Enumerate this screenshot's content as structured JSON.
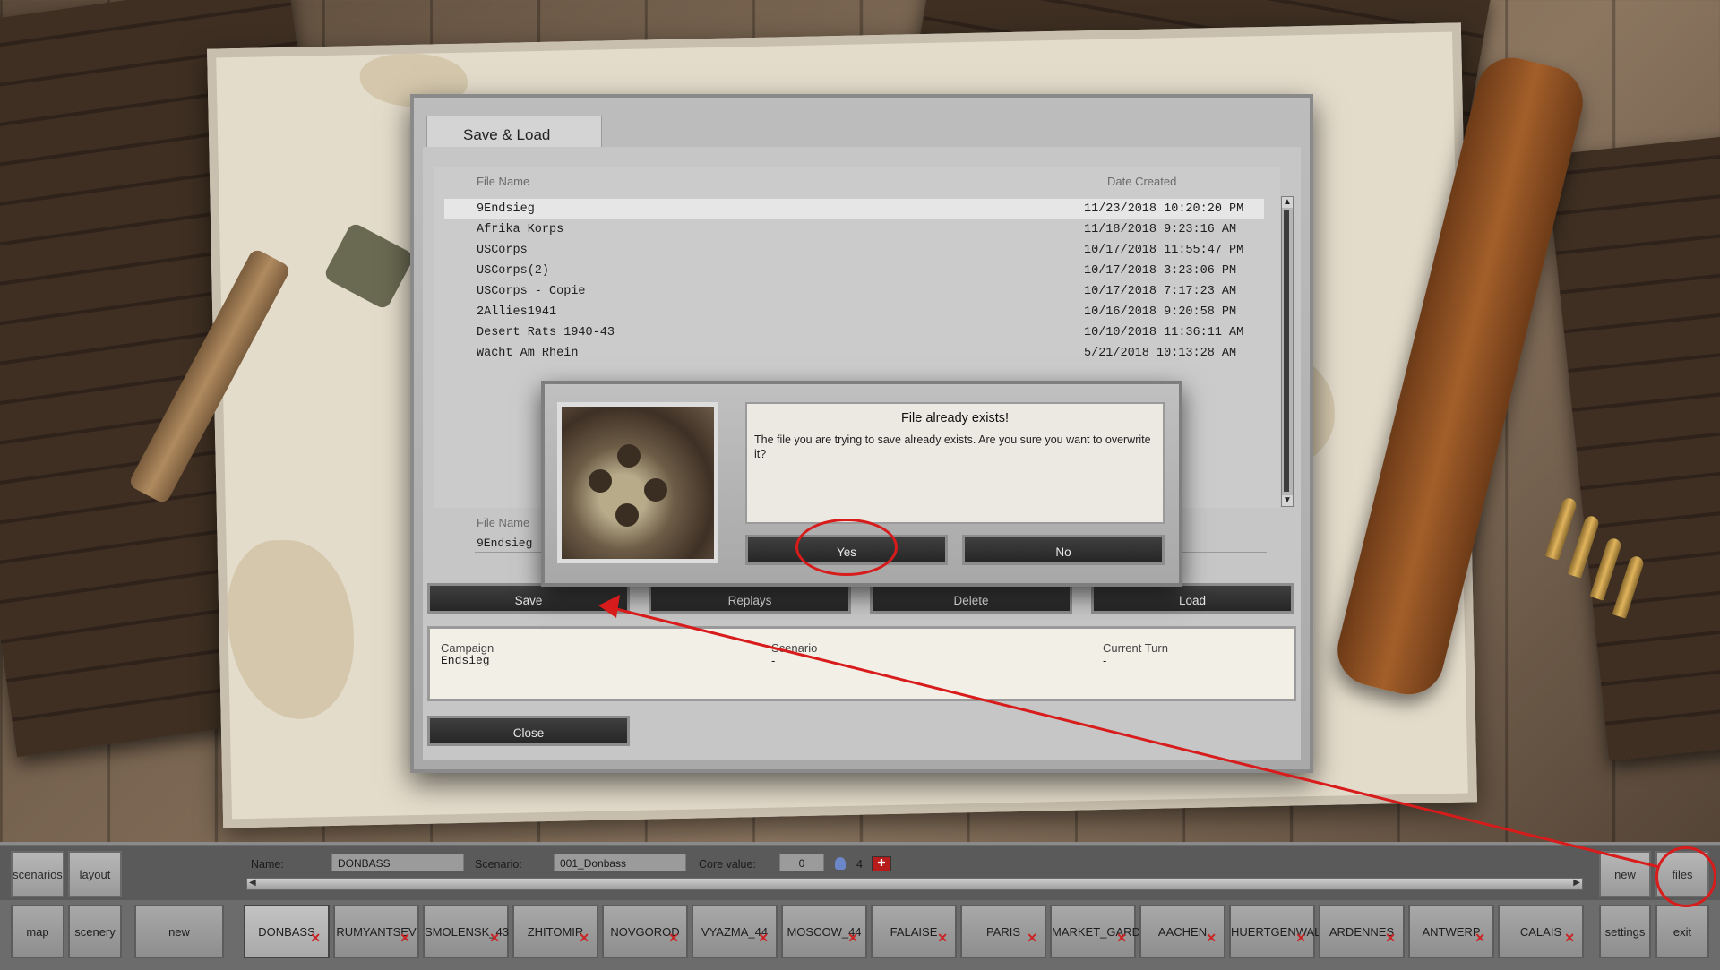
{
  "dialog": {
    "tab": "Save & Load",
    "columns": {
      "file_name": "File Name",
      "date_created": "Date Created"
    },
    "files": [
      {
        "name": "9Endsieg",
        "date": "11/23/2018 10:20:20 PM"
      },
      {
        "name": "Afrika Korps",
        "date": "11/18/2018 9:23:16 AM"
      },
      {
        "name": "USCorps",
        "date": "10/17/2018 11:55:47 PM"
      },
      {
        "name": "USCorps(2)",
        "date": "10/17/2018 3:23:06 PM"
      },
      {
        "name": "USCorps - Copie",
        "date": "10/17/2018 7:17:23 AM"
      },
      {
        "name": "2Allies1941",
        "date": "10/16/2018 9:20:58 PM"
      },
      {
        "name": "Desert Rats 1940-43",
        "date": "10/10/2018 11:36:11 AM"
      },
      {
        "name": "Wacht Am Rhein",
        "date": "5/21/2018 10:13:28 AM"
      }
    ],
    "file_name_label": "File Name",
    "file_name_value": "9Endsieg",
    "buttons": {
      "save": "Save",
      "replays": "Replays",
      "delete": "Delete",
      "load": "Load",
      "close": "Close"
    },
    "info": {
      "campaign_label": "Campaign",
      "campaign_value": "Endsieg",
      "scenario_label": "Scenario",
      "scenario_value": "-",
      "turn_label": "Current Turn",
      "turn_value": "-"
    }
  },
  "popup": {
    "title": "File already exists!",
    "message": "The file you are trying to save already exists. Are you sure you want to overwrite it?",
    "yes": "Yes",
    "no": "No"
  },
  "toolbar": {
    "scenarios": "scenarios",
    "layout": "layout",
    "name_label": "Name:",
    "name_value": "DONBASS",
    "scenario_label": "Scenario:",
    "scenario_value": "001_Donbass",
    "core_label": "Core value:",
    "core_value": "0",
    "count": "4",
    "new_top": "new",
    "files": "files",
    "map": "map",
    "scenery": "scenery",
    "new_bottom": "new",
    "settings": "settings",
    "exit": "exit",
    "scenarios_list": [
      "DONBASS",
      "RUMYANTSEV",
      "SMOLENSK_43",
      "ZHITOMIR",
      "NOVGOROD",
      "VYAZMA_44",
      "MOSCOW_44",
      "FALAISE",
      "PARIS",
      "MARKET_GARDEN",
      "AACHEN",
      "HUERTGENWALD",
      "ARDENNES",
      "ANTWERP",
      "CALAIS"
    ]
  },
  "annotation_color": "#d81b1b"
}
